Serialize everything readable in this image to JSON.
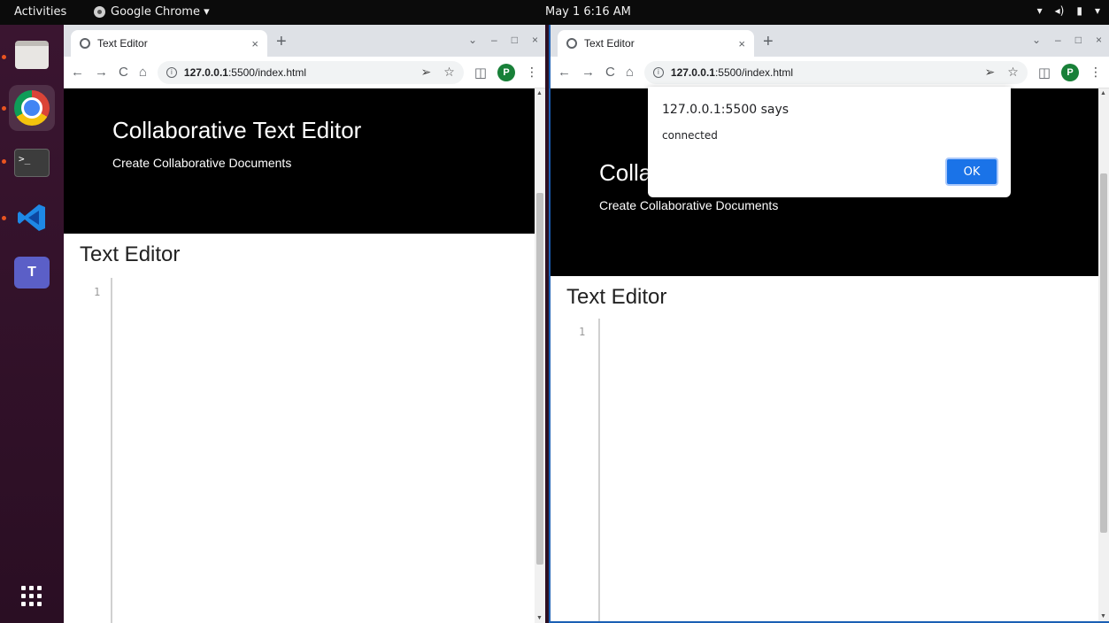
{
  "topbar": {
    "activities": "Activities",
    "app_name": "Google Chrome ▾",
    "clock": "May 1  6:16 AM",
    "tray": [
      "▾",
      "◂)",
      "▮",
      "▾"
    ]
  },
  "left_window": {
    "tab_title": "Text Editor",
    "tab_close": "×",
    "new_tab": "+",
    "url_host": "127.0.0.1",
    "url_rest": ":5500/index.html",
    "profile_initial": "P",
    "banner_title": "Collaborative Text Editor",
    "banner_subtitle": "Create Collaborative Documents",
    "editor_heading": "Text Editor",
    "line_number": "1",
    "window_controls": [
      "⌄",
      "–",
      "□",
      "×"
    ]
  },
  "right_window": {
    "tab_title": "Text Editor",
    "tab_close": "×",
    "new_tab": "+",
    "url_host": "127.0.0.1",
    "url_rest": ":5500/index.html",
    "profile_initial": "P",
    "banner_title": "Colla",
    "banner_subtitle": "Create Collaborative Documents",
    "editor_heading": "Text Editor",
    "line_number": "1",
    "window_controls": [
      "⌄",
      "–",
      "□",
      "×"
    ]
  },
  "dialog": {
    "title": "127.0.0.1:5500 says",
    "message": "connected",
    "ok_label": "OK"
  },
  "nav": {
    "back": "←",
    "forward": "→",
    "reload": "C",
    "home": "⌂",
    "send": "➢",
    "star": "☆",
    "sidepanel": "◫",
    "menu": "⋮",
    "info": "i"
  },
  "scroll": {
    "up": "▲",
    "down": "▼"
  },
  "icons": [
    "files-icon",
    "chrome-icon",
    "terminal-icon",
    "vscode-icon",
    "teams-icon",
    "show-apps-icon"
  ]
}
